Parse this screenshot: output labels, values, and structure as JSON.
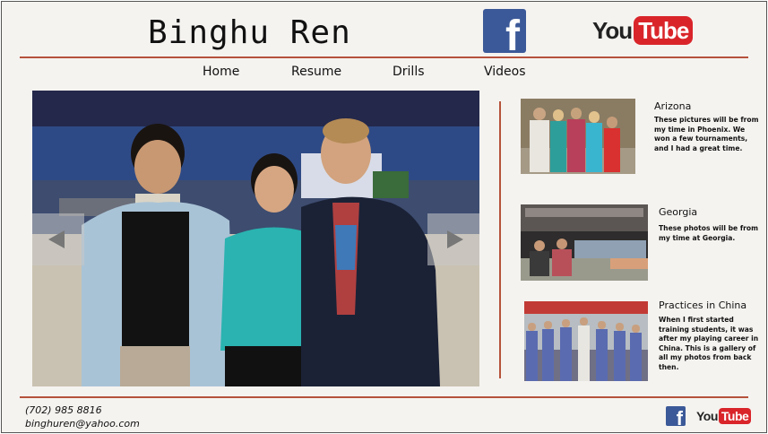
{
  "header": {
    "title": "Binghu Ren",
    "facebook_icon": "facebook-icon",
    "youtube_icon": "youtube-icon",
    "youtube_you": "You",
    "youtube_tube": "Tube"
  },
  "nav": [
    {
      "label": "Home"
    },
    {
      "label": "Resume"
    },
    {
      "label": "Drills"
    },
    {
      "label": "Videos"
    }
  ],
  "slideshow": {
    "prev_icon": "chevron-left-icon",
    "next_icon": "chevron-right-icon"
  },
  "galleries": [
    {
      "title": "Arizona",
      "description": "These pictures will be from my time in Phoenix. We won a few tournaments, and I had a great time."
    },
    {
      "title": "Georgia",
      "description": "These photos will be from my time at Georgia."
    },
    {
      "title": "Practices in China",
      "description": "When I first started training students, it was after my playing career in China. This is a gallery of all my photos from back then."
    }
  ],
  "footer": {
    "phone": "(702) 985 8816",
    "email": "binghuren@yahoo.com",
    "youtube_you": "You",
    "youtube_tube": "Tube"
  },
  "colors": {
    "accent_rule": "#b5523b",
    "facebook": "#3b5998",
    "youtube_red": "#d9252a",
    "background": "#f5f3f0"
  }
}
